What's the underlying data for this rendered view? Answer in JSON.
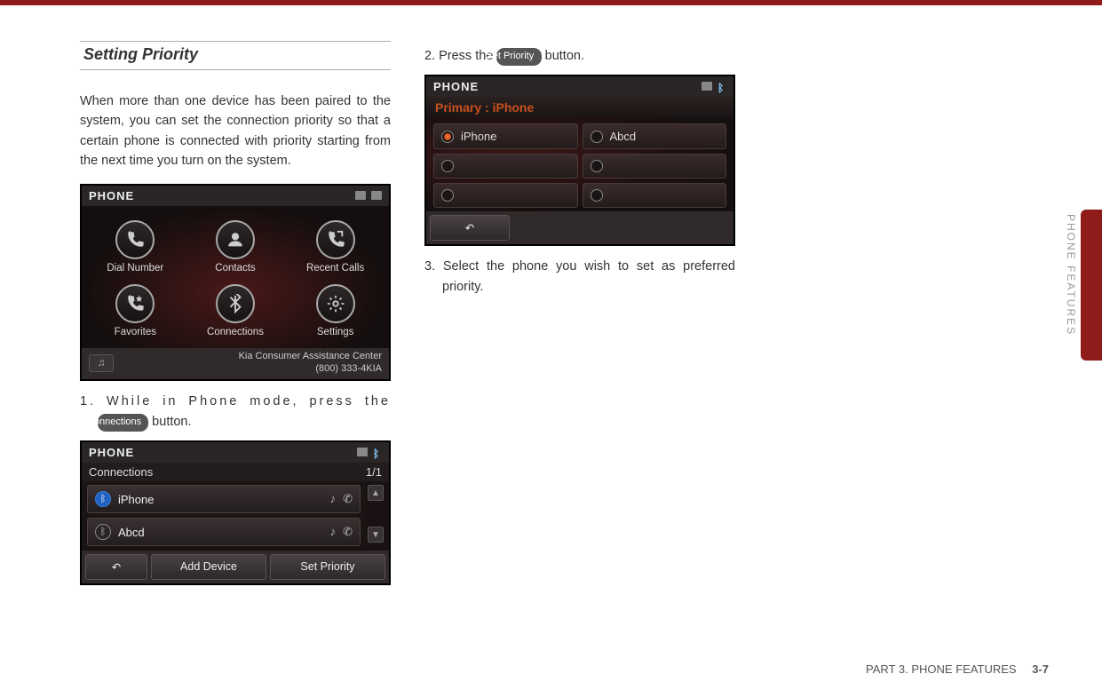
{
  "header": {
    "title": "Setting Priority"
  },
  "intro": "When more than one device has been paired to the system, you can set the connection priority so that a certain phone is connected with priority starting from the next time you turn on the system.",
  "steps": {
    "s1a": "1. While in Phone mode, press the ",
    "s1_btn": "Connections",
    "s1b": " button.",
    "s2a": "2. Press the ",
    "s2_btn": "Set Priority",
    "s2b": " button.",
    "s3": "3. Select the phone you wish to set as preferred priority."
  },
  "shot1": {
    "title": "PHONE",
    "tiles": [
      "Dial Number",
      "Contacts",
      "Recent Calls",
      "Favorites",
      "Connections",
      "Settings"
    ],
    "assist1": "Kia Consumer Assistance Center",
    "assist2": "(800) 333-4KIA"
  },
  "shot2": {
    "title": "PHONE",
    "sub": "Connections",
    "page": "1/1",
    "rows": [
      {
        "name": "iPhone",
        "active": true
      },
      {
        "name": "Abcd",
        "active": false
      }
    ],
    "buttons": {
      "add": "Add Device",
      "set": "Set Priority"
    }
  },
  "shot3": {
    "title": "PHONE",
    "primary_label": "Primary :",
    "primary_value": "iPhone",
    "cells": [
      {
        "name": "iPhone",
        "selected": true
      },
      {
        "name": "Abcd",
        "selected": false
      },
      {
        "name": "",
        "selected": false
      },
      {
        "name": "",
        "selected": false
      },
      {
        "name": "",
        "selected": false
      },
      {
        "name": "",
        "selected": false
      }
    ]
  },
  "side": {
    "label": "PHONE FEATURES"
  },
  "footer": {
    "part": "PART 3. PHONE FEATURES",
    "page": "3-7"
  }
}
